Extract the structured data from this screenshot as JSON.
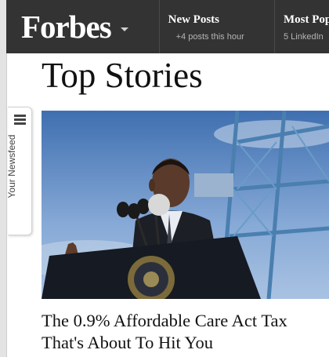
{
  "header": {
    "logo": "Forbes",
    "nav": [
      {
        "title": "New Posts",
        "subtitle": "+4 posts this hour"
      },
      {
        "title": "Most Popular",
        "subtitle": "5 LinkedIn"
      }
    ]
  },
  "sidebar_tab": {
    "label": "Your Newsfeed",
    "icon": "hamburger-menu-icon"
  },
  "main": {
    "section_title": "Top Stories",
    "story": {
      "image": "speaker-at-podium-with-cranes",
      "headline": "The 0.9% Affordable Care Act Tax That's About To Hit You"
    }
  },
  "colors": {
    "header_bg": "#333333",
    "header_text": "#ffffff",
    "subtext": "#b5b5b5",
    "body_text": "#111111"
  }
}
